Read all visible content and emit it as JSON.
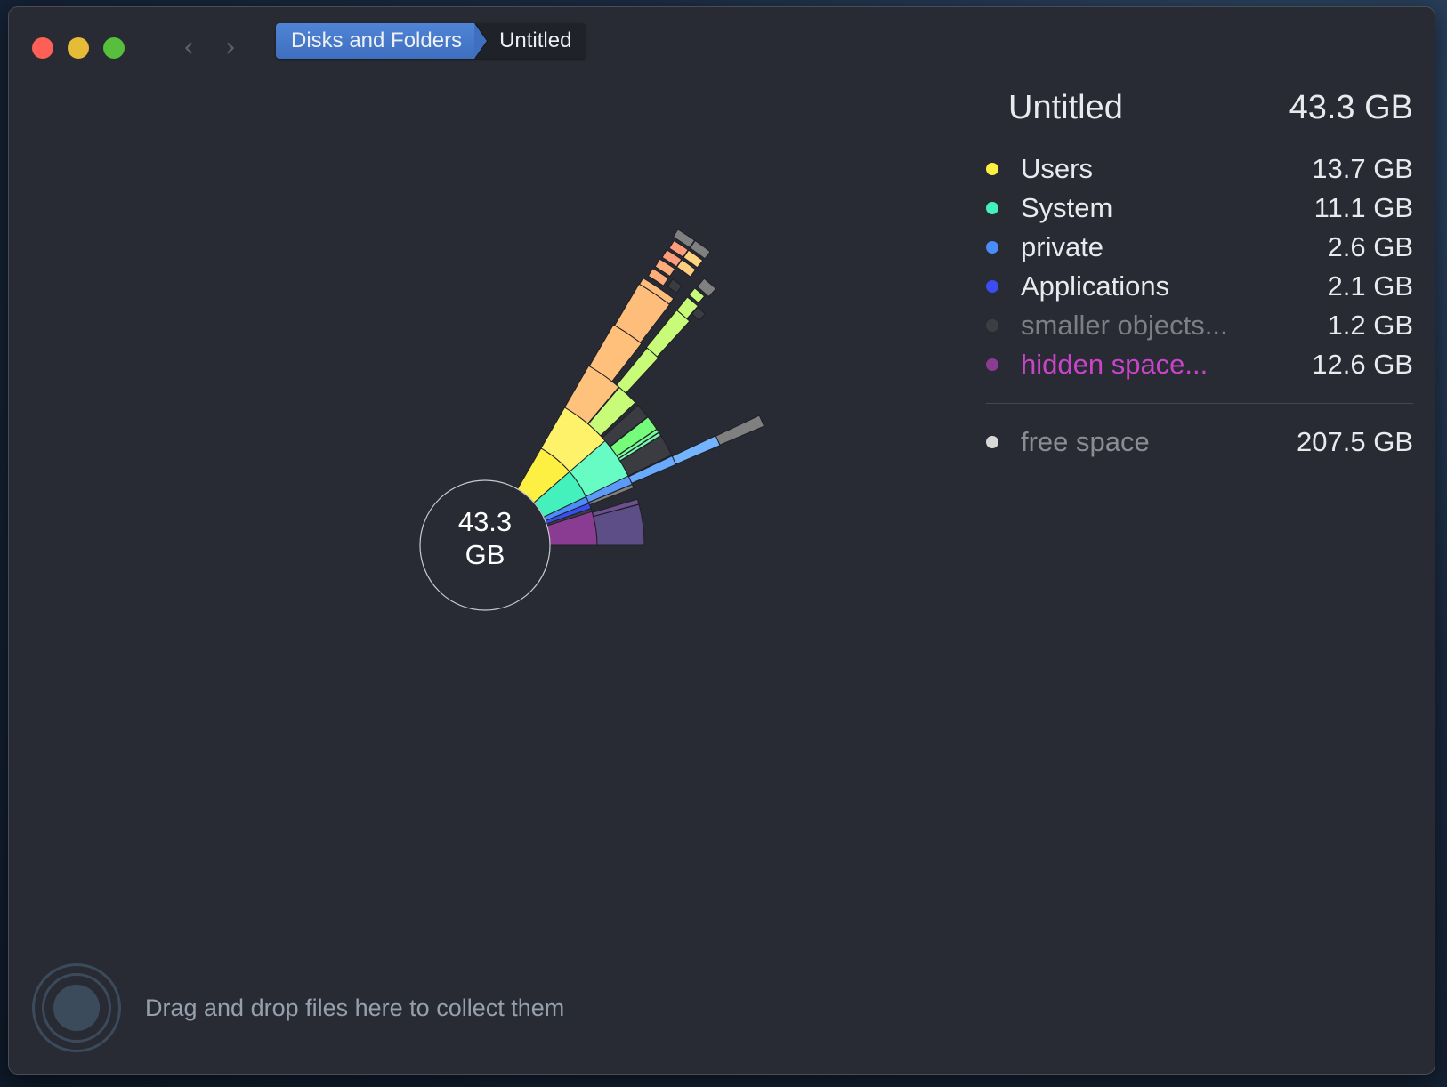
{
  "window": {
    "nav": {
      "back_icon": "chevron-left-icon",
      "forward_icon": "chevron-right-icon",
      "back_glyph": "‹",
      "forward_glyph": "›"
    },
    "breadcrumb": [
      {
        "label": "Disks and Folders",
        "active": true
      },
      {
        "label": "Untitled",
        "active": false
      }
    ]
  },
  "legend": {
    "title": "Untitled",
    "total": "43.3 GB",
    "items": [
      {
        "label": "Users",
        "value": "13.7 GB",
        "color": "#fef042",
        "label_color": "#e8eaee"
      },
      {
        "label": "System",
        "value": "11.1 GB",
        "color": "#44f0bb",
        "label_color": "#e8eaee"
      },
      {
        "label": "private",
        "value": "2.6 GB",
        "color": "#4a8cf8",
        "label_color": "#e8eaee"
      },
      {
        "label": "Applications",
        "value": "2.1 GB",
        "color": "#3b4cf0",
        "label_color": "#e8eaee"
      },
      {
        "label": "smaller objects...",
        "value": "1.2 GB",
        "color": "#3c3e44",
        "label_color": "#7c7f86"
      },
      {
        "label": "hidden space...",
        "value": "12.6 GB",
        "color": "#8a3c92",
        "label_color": "#c944c9"
      }
    ],
    "free": {
      "label": "free space",
      "value": "207.5 GB",
      "color": "#d8d8d8",
      "label_color": "#8a8d93"
    }
  },
  "chart_data": {
    "type": "sunburst",
    "title": "Untitled",
    "center_label_line1": "43.3",
    "center_label_line2": "GB",
    "unit": "GB",
    "total": 43.3,
    "free_space": 207.5,
    "categories": [
      "Users",
      "System",
      "private",
      "Applications",
      "smaller objects...",
      "hidden space..."
    ],
    "values": [
      13.7,
      11.1,
      2.6,
      2.1,
      1.2,
      12.6
    ],
    "colors": [
      "#fef042",
      "#44f0bb",
      "#4a8cf8",
      "#3b4cf0",
      "#3c3e44",
      "#8a3c92"
    ]
  },
  "drop_zone": {
    "icon": "drop-target-icon",
    "text": "Drag and drop files here to collect them"
  }
}
